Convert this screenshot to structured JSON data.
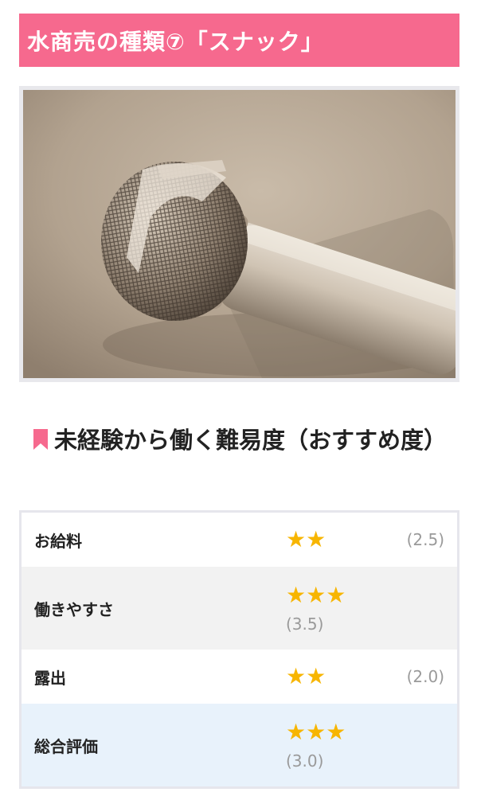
{
  "heading": "水商売の種類⑦「スナック」",
  "section_title": "未経験から働く難易度（おすすめ度）",
  "ratings": [
    {
      "label": "お給料",
      "stars": "★★",
      "score": "(2.5)"
    },
    {
      "label": "働きやすさ",
      "stars": "★★★",
      "score": "(3.5)"
    },
    {
      "label": "露出",
      "stars": "★★",
      "score": "(2.0)"
    },
    {
      "label": "総合評価",
      "stars": "★★★",
      "score": "(3.0)"
    }
  ],
  "colors": {
    "banner": "#f6698e",
    "star": "#f7b500",
    "bookmark": "#f6698e",
    "total_row": "#e8f2fb"
  },
  "icons": {
    "section": "bookmark-icon",
    "rating": "star-icon"
  }
}
